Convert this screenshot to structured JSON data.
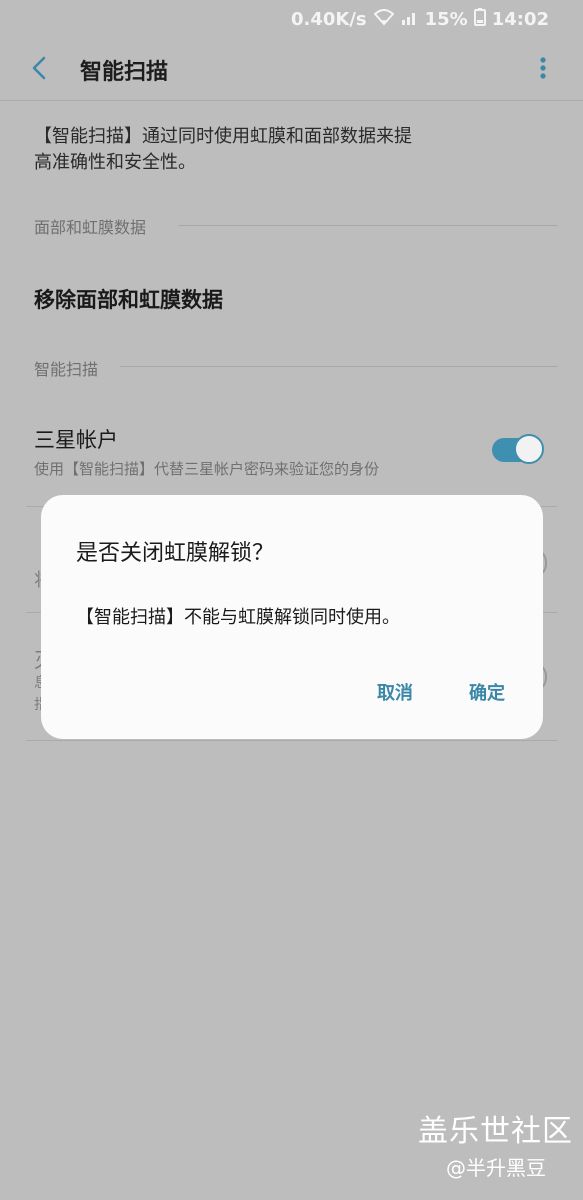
{
  "status_bar": {
    "speed": "0.40K/s",
    "battery": "15%",
    "time": "14:02"
  },
  "header": {
    "title": "智能扫描",
    "back_icon": "chevron-left-icon",
    "more_icon": "more-vert-icon"
  },
  "description": {
    "line1": "【智能扫描】通过同时使用虹膜和面部数据来提",
    "line2": "高准确性和安全性。"
  },
  "sections": {
    "face_iris_header": "面部和虹膜数据",
    "remove_label": "移除面部和虹膜数据",
    "smart_scan_header": "智能扫描"
  },
  "samsung_account": {
    "title": "三星帐户",
    "subtitle": "使用【智能扫描】代替三星帐户密码来验证您的身份",
    "toggle_on": true
  },
  "partially_hidden": {
    "char1": "将",
    "char2": "灭",
    "char3": "息",
    "char4": "指"
  },
  "dialog": {
    "title": "是否关闭虹膜解锁？",
    "message": "【智能扫描】不能与虹膜解锁同时使用。",
    "cancel": "取消",
    "confirm": "确定"
  },
  "watermark": {
    "line1": "盖乐世社区",
    "line2": "@半升黑豆"
  },
  "colors": {
    "accent": "#3a87a8",
    "background": "#bdbdbd",
    "dialog": "#fbfbfb"
  }
}
